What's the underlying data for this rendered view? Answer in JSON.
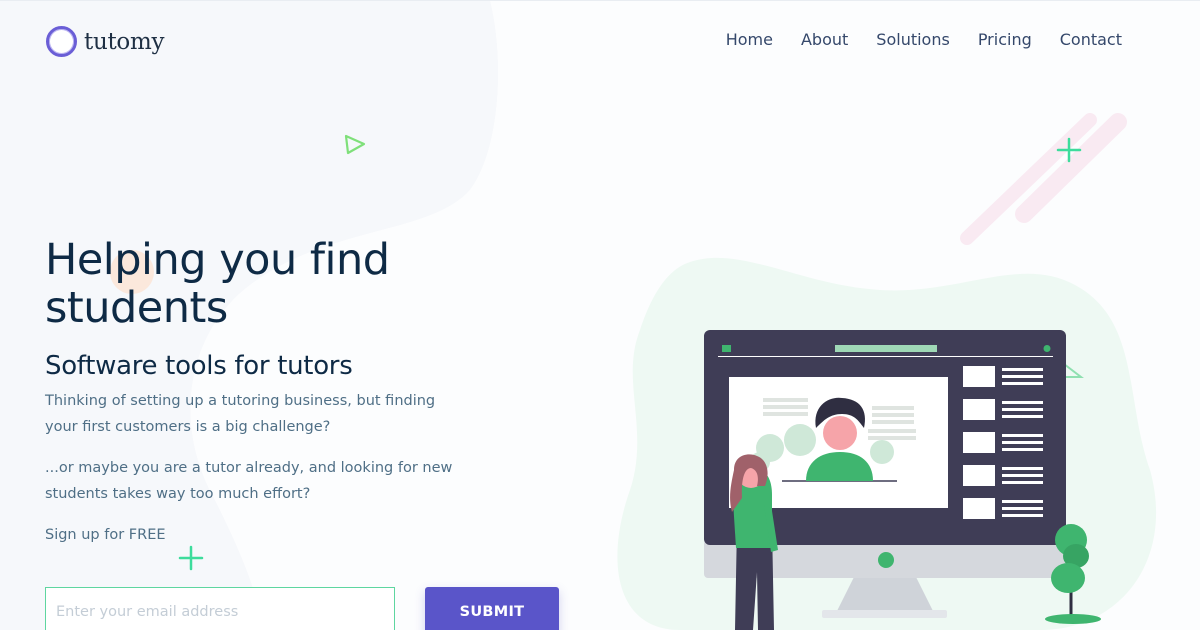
{
  "brand": {
    "name": "tutomy"
  },
  "nav": {
    "items": [
      {
        "label": "Home"
      },
      {
        "label": "About"
      },
      {
        "label": "Solutions"
      },
      {
        "label": "Pricing"
      },
      {
        "label": "Contact"
      }
    ]
  },
  "hero": {
    "title": "Helping you find students",
    "subtitle": "Software tools for tutors",
    "paragraph1": "Thinking of setting up a tutoring business, but finding your first customers is a big challenge?",
    "paragraph2": "...or maybe you are a tutor already, and looking for new students takes way too much effort?",
    "signup_text": "Sign up for FREE"
  },
  "form": {
    "email_placeholder": "Enter your email address",
    "email_value": "",
    "submit_label": "SUBMIT"
  },
  "colors": {
    "accent": "#5a55c9",
    "brand_ring": "#6a5ed6",
    "heading": "#0e2a45",
    "body_text": "#4f6f86",
    "illustration_green": "#3fb56f",
    "input_border": "#5ed6a0"
  },
  "icons": {
    "logo": "ring-logo-icon",
    "decorations": [
      "triangle-outline-icon",
      "plus-icon"
    ]
  }
}
